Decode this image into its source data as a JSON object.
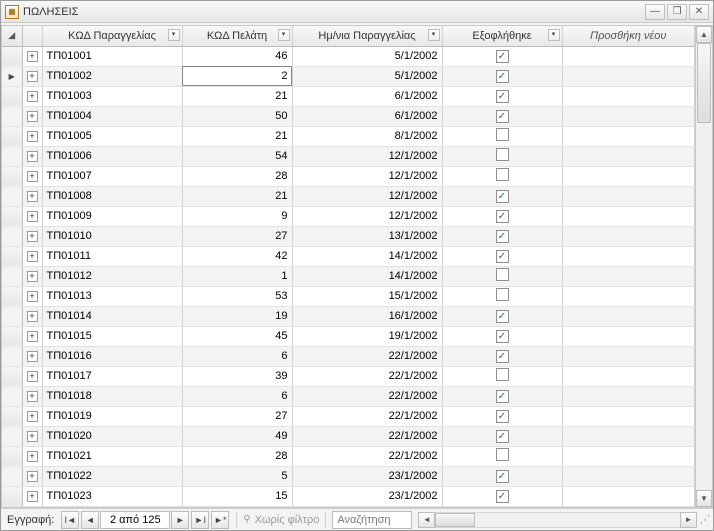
{
  "window": {
    "title": "ΠΩΛΗΣΕΙΣ"
  },
  "columns": {
    "c1": "ΚΩΔ Παραγγελίας",
    "c2": "ΚΩΔ Πελάτη",
    "c3": "Ημ/νια Παραγγελίας",
    "c4": "Εξοφλήθηκε",
    "c5": "Προσθήκη νέου"
  },
  "selected_row_index": 1,
  "editing": {
    "row_index": 1,
    "col": "c2"
  },
  "rows": [
    {
      "c1": "ΤΠ01001",
      "c2": "46",
      "c3": "5/1/2002",
      "c4": true
    },
    {
      "c1": "ΤΠ01002",
      "c2": "2",
      "c3": "5/1/2002",
      "c4": true
    },
    {
      "c1": "ΤΠ01003",
      "c2": "21",
      "c3": "6/1/2002",
      "c4": true
    },
    {
      "c1": "ΤΠ01004",
      "c2": "50",
      "c3": "6/1/2002",
      "c4": true
    },
    {
      "c1": "ΤΠ01005",
      "c2": "21",
      "c3": "8/1/2002",
      "c4": false
    },
    {
      "c1": "ΤΠ01006",
      "c2": "54",
      "c3": "12/1/2002",
      "c4": false
    },
    {
      "c1": "ΤΠ01007",
      "c2": "28",
      "c3": "12/1/2002",
      "c4": false
    },
    {
      "c1": "ΤΠ01008",
      "c2": "21",
      "c3": "12/1/2002",
      "c4": true
    },
    {
      "c1": "ΤΠ01009",
      "c2": "9",
      "c3": "12/1/2002",
      "c4": true
    },
    {
      "c1": "ΤΠ01010",
      "c2": "27",
      "c3": "13/1/2002",
      "c4": true
    },
    {
      "c1": "ΤΠ01011",
      "c2": "42",
      "c3": "14/1/2002",
      "c4": true
    },
    {
      "c1": "ΤΠ01012",
      "c2": "1",
      "c3": "14/1/2002",
      "c4": false
    },
    {
      "c1": "ΤΠ01013",
      "c2": "53",
      "c3": "15/1/2002",
      "c4": false
    },
    {
      "c1": "ΤΠ01014",
      "c2": "19",
      "c3": "16/1/2002",
      "c4": true
    },
    {
      "c1": "ΤΠ01015",
      "c2": "45",
      "c3": "19/1/2002",
      "c4": true
    },
    {
      "c1": "ΤΠ01016",
      "c2": "6",
      "c3": "22/1/2002",
      "c4": true
    },
    {
      "c1": "ΤΠ01017",
      "c2": "39",
      "c3": "22/1/2002",
      "c4": false
    },
    {
      "c1": "ΤΠ01018",
      "c2": "6",
      "c3": "22/1/2002",
      "c4": true
    },
    {
      "c1": "ΤΠ01019",
      "c2": "27",
      "c3": "22/1/2002",
      "c4": true
    },
    {
      "c1": "ΤΠ01020",
      "c2": "49",
      "c3": "22/1/2002",
      "c4": true
    },
    {
      "c1": "ΤΠ01021",
      "c2": "28",
      "c3": "22/1/2002",
      "c4": false
    },
    {
      "c1": "ΤΠ01022",
      "c2": "5",
      "c3": "23/1/2002",
      "c4": true
    },
    {
      "c1": "ΤΠ01023",
      "c2": "15",
      "c3": "23/1/2002",
      "c4": true
    }
  ],
  "footer": {
    "record_label": "Εγγραφή:",
    "record_pos": "2 από 125",
    "filter_off": "Χωρίς φίλτρο",
    "search_placeholder": "Αναζήτηση"
  }
}
